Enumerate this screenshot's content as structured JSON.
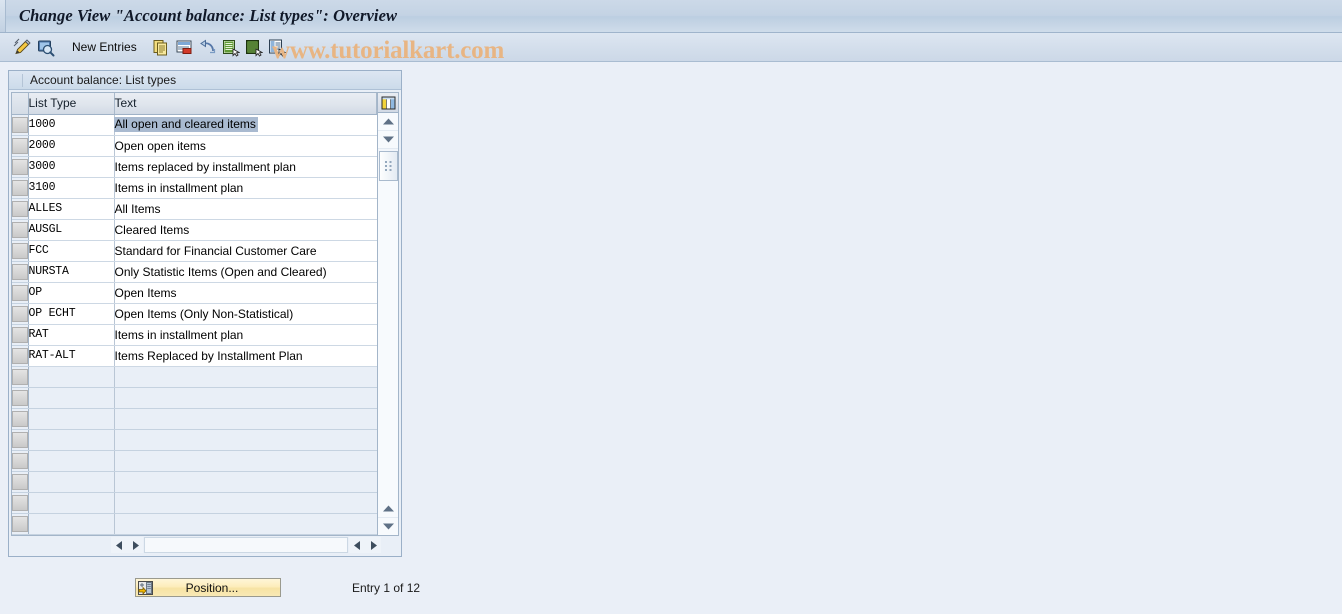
{
  "window": {
    "title": "Change View \"Account balance: List types\": Overview"
  },
  "toolbar": {
    "icons_left": [
      {
        "name": "display-change-icon",
        "title": "Display/Change"
      },
      {
        "name": "check-entries-icon",
        "title": "Check Entries"
      }
    ],
    "new_entries_label": "New Entries",
    "icons_right": [
      {
        "name": "copy-as-icon",
        "title": "Copy As..."
      },
      {
        "name": "delete-icon",
        "title": "Delete"
      },
      {
        "name": "undo-icon",
        "title": "Undo Change"
      },
      {
        "name": "select-all-icon",
        "title": "Select All"
      },
      {
        "name": "deselect-all-icon",
        "title": "Deselect All"
      },
      {
        "name": "variants-icon",
        "title": "Select Block"
      }
    ]
  },
  "watermark": "www.tutorialkart.com",
  "panel": {
    "header": "Account balance: List types"
  },
  "table": {
    "columns": [
      {
        "key": "list_type",
        "label": "List Type"
      },
      {
        "key": "text",
        "label": "Text"
      }
    ],
    "selected_row": 0,
    "rows": [
      {
        "list_type": "1000",
        "text": "All open and cleared items"
      },
      {
        "list_type": "2000",
        "text": "Open open items"
      },
      {
        "list_type": "3000",
        "text": "Items replaced by installment plan"
      },
      {
        "list_type": "3100",
        "text": "Items in installment plan"
      },
      {
        "list_type": "ALLES",
        "text": "All Items"
      },
      {
        "list_type": "AUSGL",
        "text": "Cleared Items"
      },
      {
        "list_type": "FCC",
        "text": "Standard for Financial Customer Care"
      },
      {
        "list_type": "NURSTA",
        "text": "Only Statistic Items (Open and Cleared)"
      },
      {
        "list_type": "OP",
        "text": "Open Items"
      },
      {
        "list_type": "OP ECHT",
        "text": "Open Items (Only Non-Statistical)"
      },
      {
        "list_type": "RAT",
        "text": "Items in installment plan"
      },
      {
        "list_type": "RAT-ALT",
        "text": "Items Replaced by Installment Plan"
      }
    ],
    "empty_row_count": 8,
    "column_config_icon": "table-settings-icon"
  },
  "scrollbars": {
    "v_up_icon": "scroll-up-icon",
    "v_down_icon": "scroll-down-icon",
    "v_thumb_icon": "scroll-thumb-grip",
    "h_left_icon": "scroll-left-icon",
    "h_right_icon": "scroll-right-icon"
  },
  "footer": {
    "position_label": "Position...",
    "position_icon": "position-icon",
    "entry_info": "Entry 1 of 12"
  },
  "colors": {
    "page_background": "#eaeff7",
    "titlebar": "#c4d3e4",
    "grid_row_filled": "#ffffff",
    "grid_row_empty": "#e9eff7",
    "selection_highlight": "#a9bad0",
    "watermark": "#e8b583",
    "button_yellow": "#f7e3a4"
  }
}
